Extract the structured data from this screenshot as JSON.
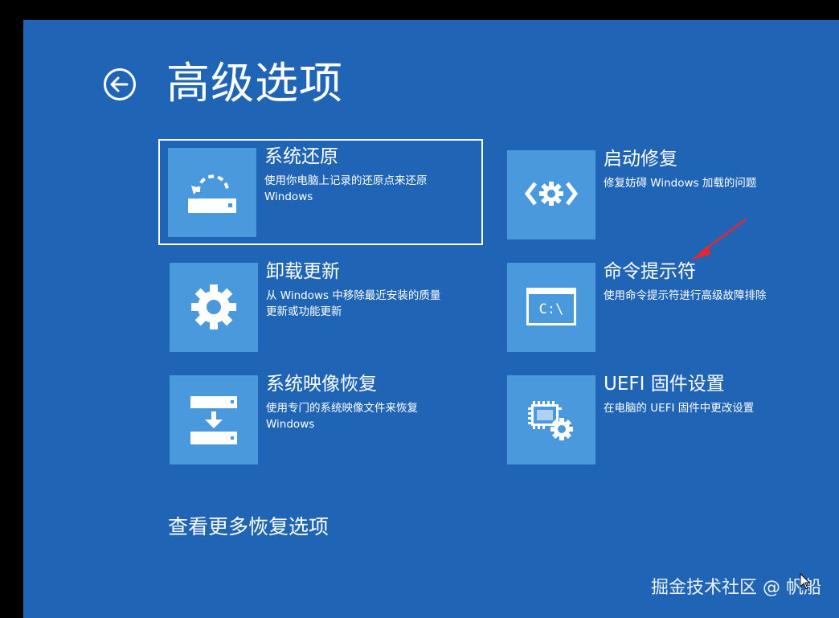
{
  "page": {
    "title": "高级选项",
    "back_icon": "back-arrow-circle-icon"
  },
  "options": [
    {
      "title": "系统还原",
      "desc_line1": "使用你电脑上记录的还原点来还原",
      "desc_line2": "Windows",
      "icon": "system-restore-icon",
      "selected": true
    },
    {
      "title": "启动修复",
      "desc_line1": "修复妨碍 Windows 加载的问题",
      "desc_line2": "",
      "icon": "startup-repair-icon",
      "selected": false
    },
    {
      "title": "卸载更新",
      "desc_line1": "从 Windows 中移除最近安装的质量",
      "desc_line2": "更新或功能更新",
      "icon": "gear-icon",
      "selected": false
    },
    {
      "title": "命令提示符",
      "desc_line1": "使用命令提示符进行高级故障排除",
      "desc_line2": "",
      "icon": "command-prompt-icon",
      "selected": false
    },
    {
      "title": "系统映像恢复",
      "desc_line1": "使用专门的系统映像文件来恢复",
      "desc_line2": "Windows",
      "icon": "system-image-recovery-icon",
      "selected": false
    },
    {
      "title": "UEFI 固件设置",
      "desc_line1": "在电脑的 UEFI 固件中更改设置",
      "desc_line2": "",
      "icon": "uefi-firmware-icon",
      "selected": false
    }
  ],
  "cmd_icon_text": "C:\\",
  "more_link": "查看更多恢复选项",
  "watermark": "掘金技术社区 @ 帆船",
  "colors": {
    "background": "#2065b5",
    "tile": "#4a99dc",
    "text": "#ffffff",
    "annotation_arrow": "#e8262d"
  }
}
